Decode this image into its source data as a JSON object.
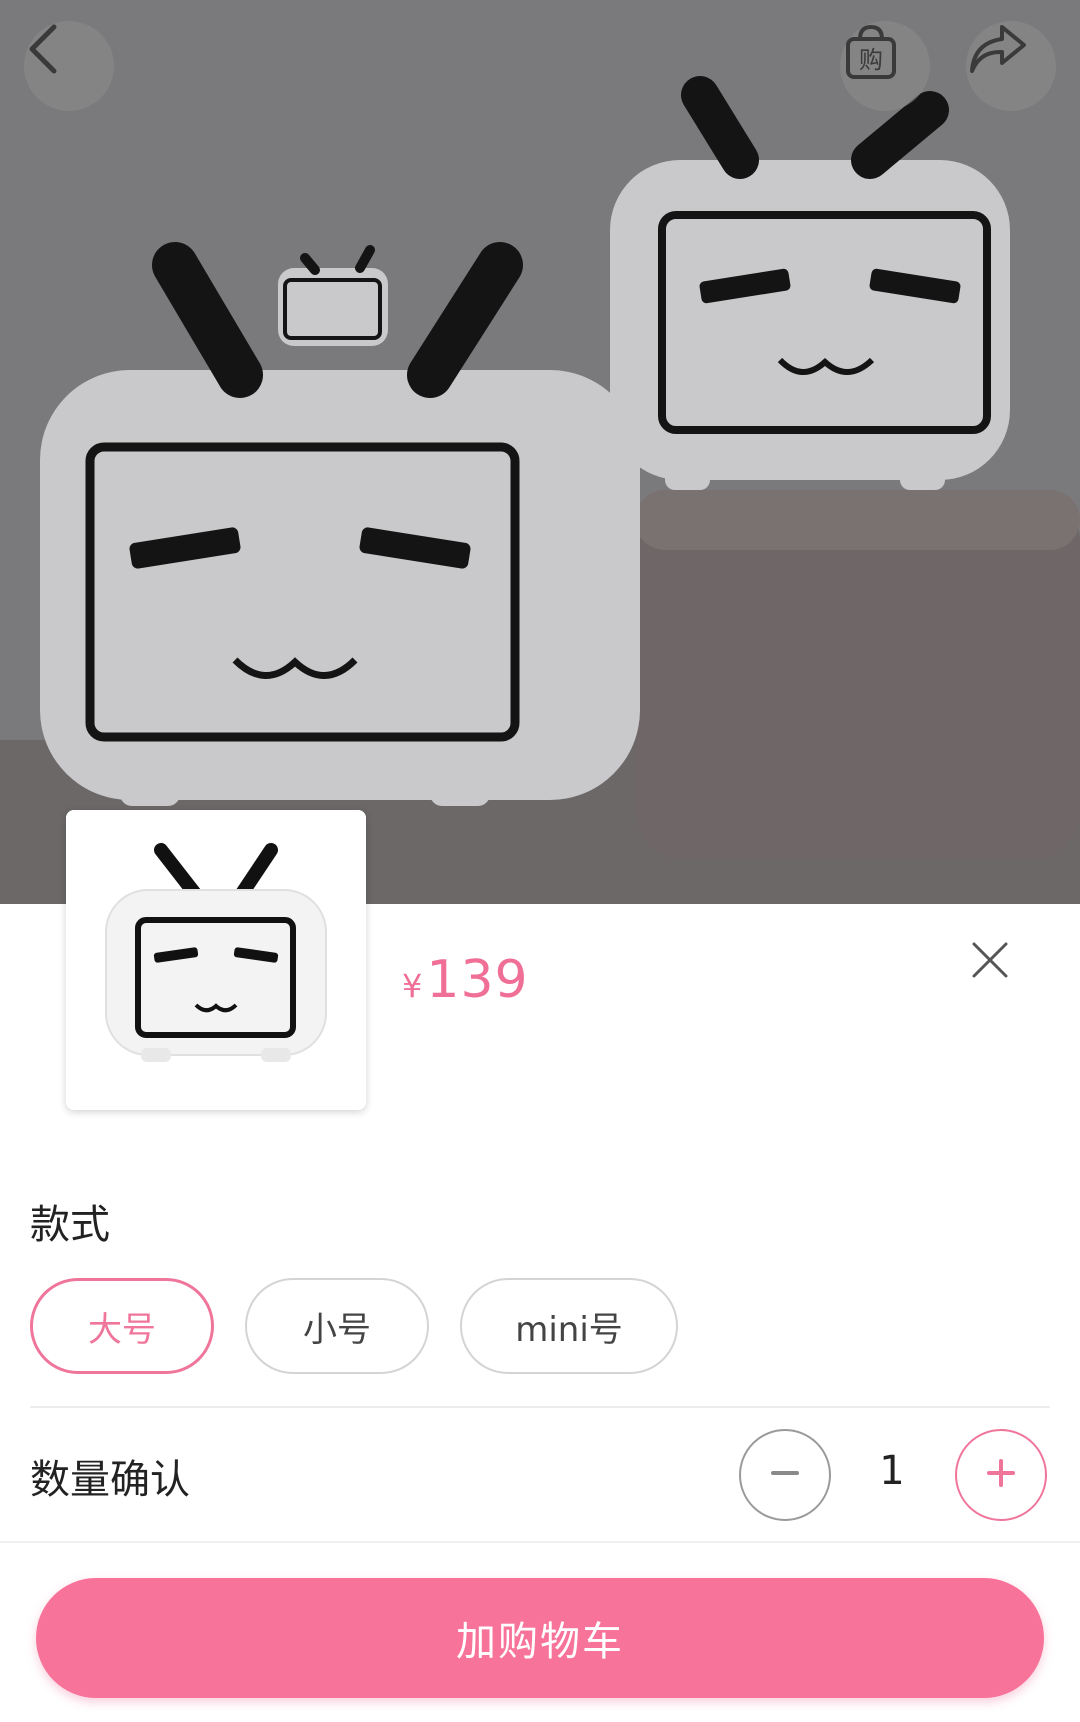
{
  "header": {
    "back_icon": "back-arrow-icon",
    "cart_icon": "shopping-bag-icon",
    "cart_glyph": "购",
    "share_icon": "share-icon"
  },
  "product": {
    "price_symbol": "¥",
    "price": "139",
    "close_icon": "close-icon"
  },
  "style_section": {
    "title": "款式",
    "options": [
      "大号",
      "小号",
      "mini号"
    ],
    "selected_index": 0
  },
  "quantity": {
    "label": "数量确认",
    "value": "1",
    "minus_label": "−",
    "plus_label": "+"
  },
  "action": {
    "add_to_cart": "加购物车"
  },
  "colors": {
    "accent": "#f0759b",
    "button": "#f8739a"
  }
}
